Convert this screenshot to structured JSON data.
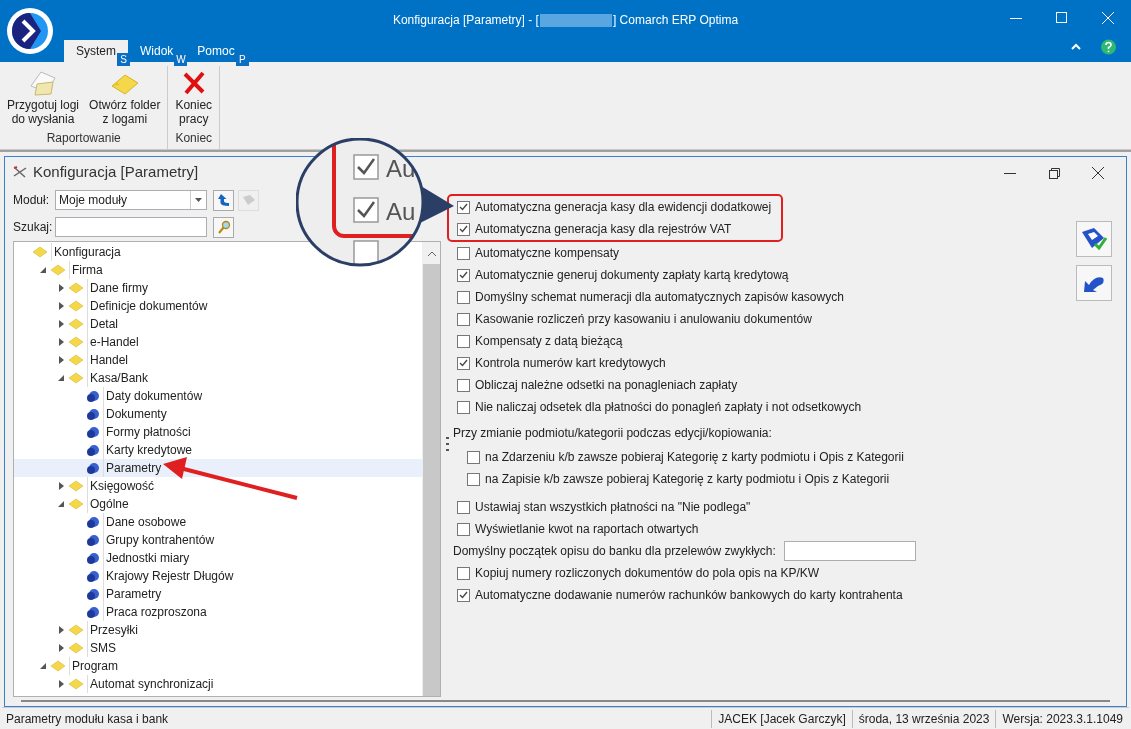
{
  "window": {
    "title_before": "Konfiguracja [Parametry] - [",
    "title_after": "] Comarch ERP Optima"
  },
  "ribbon": {
    "tabs": [
      {
        "label": "System",
        "key": "S",
        "selected": true
      },
      {
        "label": "Widok",
        "key": "W",
        "selected": false
      },
      {
        "label": "Pomoc",
        "key": "P",
        "selected": false
      }
    ],
    "groups": [
      {
        "label": "Raportowanie",
        "buttons": [
          {
            "label": "Przygotuj logi\ndo wysłania",
            "kind": "envelope"
          },
          {
            "label": "Otwórz folder\nz logami",
            "kind": "folder"
          }
        ]
      },
      {
        "label": "Koniec",
        "buttons": [
          {
            "label": "Koniec\npracy",
            "kind": "exit"
          }
        ]
      }
    ]
  },
  "dialog": {
    "title": "Konfiguracja [Parametry]",
    "module_label": "Moduł:",
    "module_value": "Moje moduły",
    "search_label": "Szukaj:"
  },
  "tree": [
    {
      "label": "Konfiguracja",
      "kind": "folder",
      "selected": false,
      "children": [
        {
          "label": "Firma",
          "kind": "folder",
          "expanded": true,
          "selected": false,
          "children": [
            {
              "label": "Dane firmy",
              "kind": "folder",
              "expanded": false,
              "selected": false
            },
            {
              "label": "Definicje dokumentów",
              "kind": "folder",
              "expanded": false,
              "selected": false
            },
            {
              "label": "Detal",
              "kind": "folder",
              "expanded": false,
              "selected": false
            },
            {
              "label": "e-Handel",
              "kind": "folder",
              "expanded": false,
              "selected": false
            },
            {
              "label": "Handel",
              "kind": "folder",
              "expanded": false,
              "selected": false
            },
            {
              "label": "Kasa/Bank",
              "kind": "folder",
              "expanded": true,
              "selected": false,
              "children": [
                {
                  "label": "Daty dokumentów",
                  "kind": "leaf",
                  "selected": false
                },
                {
                  "label": "Dokumenty",
                  "kind": "leaf",
                  "selected": false
                },
                {
                  "label": "Formy płatności",
                  "kind": "leaf",
                  "selected": false
                },
                {
                  "label": "Karty kredytowe",
                  "kind": "leaf",
                  "selected": false
                },
                {
                  "label": "Parametry",
                  "kind": "leaf",
                  "selected": true
                }
              ]
            },
            {
              "label": "Księgowość",
              "kind": "folder",
              "expanded": false,
              "selected": false
            },
            {
              "label": "Ogólne",
              "kind": "folder",
              "expanded": true,
              "selected": false,
              "children": [
                {
                  "label": "Dane osobowe",
                  "kind": "leaf",
                  "selected": false
                },
                {
                  "label": "Grupy kontrahentów",
                  "kind": "leaf",
                  "selected": false
                },
                {
                  "label": "Jednostki miary",
                  "kind": "leaf",
                  "selected": false
                },
                {
                  "label": "Krajowy Rejestr Długów",
                  "kind": "leaf",
                  "selected": false
                },
                {
                  "label": "Parametry",
                  "kind": "leaf",
                  "selected": false
                },
                {
                  "label": "Praca rozproszona",
                  "kind": "leaf",
                  "selected": false
                }
              ]
            },
            {
              "label": "Przesyłki",
              "kind": "folder",
              "expanded": false,
              "selected": false
            },
            {
              "label": "SMS",
              "kind": "folder",
              "expanded": false,
              "selected": false
            }
          ]
        },
        {
          "label": "Program",
          "kind": "folder",
          "expanded": true,
          "selected": false,
          "children": [
            {
              "label": "Automat synchronizacji",
              "kind": "folder",
              "expanded": false,
              "selected": false
            }
          ]
        }
      ]
    }
  ],
  "settings": [
    {
      "kind": "checkbox",
      "label": "Automatyczna generacja kasy dla ewidencji dodatkowej",
      "checked": true,
      "highlighted": true
    },
    {
      "kind": "checkbox",
      "label": "Automatyczna generacja kasy dla rejestrów VAT",
      "checked": true,
      "highlighted": true
    },
    {
      "kind": "checkbox",
      "label": "Automatyczne kompensaty",
      "checked": false
    },
    {
      "kind": "checkbox",
      "label": "Automatycznie generuj dokumenty zapłaty kartą kredytową",
      "checked": true
    },
    {
      "kind": "checkbox",
      "label": "Domyślny schemat numeracji dla automatycznych zapisów kasowych",
      "checked": false
    },
    {
      "kind": "checkbox",
      "label": "Kasowanie rozliczeń przy kasowaniu i anulowaniu dokumentów",
      "checked": false
    },
    {
      "kind": "checkbox",
      "label": "Kompensaty z datą bieżącą",
      "checked": false
    },
    {
      "kind": "checkbox",
      "label": "Kontrola numerów kart kredytowych",
      "checked": true
    },
    {
      "kind": "checkbox",
      "label": "Obliczaj należne odsetki na ponagleniach zapłaty",
      "checked": false
    },
    {
      "kind": "checkbox",
      "label": "Nie naliczaj odsetek dla płatności do ponagleń zapłaty i not odsetkowych",
      "checked": false
    },
    {
      "kind": "heading",
      "label": "Przy zmianie podmiotu/kategorii podczas edycji/kopiowania:"
    },
    {
      "kind": "subcheckbox",
      "label": "na Zdarzeniu k/b zawsze pobieraj Kategorię z karty podmiotu i Opis z Kategorii",
      "checked": false
    },
    {
      "kind": "subcheckbox",
      "label": "na Zapisie k/b zawsze pobieraj Kategorię z karty podmiotu i Opis z Kategorii",
      "checked": false
    },
    {
      "kind": "checkbox",
      "label": "Ustawiaj stan wszystkich płatności na \"Nie podlega\"",
      "checked": false
    },
    {
      "kind": "checkbox",
      "label": "Wyświetlanie kwot na raportach otwartych",
      "checked": false
    },
    {
      "kind": "field",
      "label": "Domyślny początek opisu do banku dla przelewów zwykłych:"
    },
    {
      "kind": "checkbox",
      "label": "Kopiuj numery rozliczonych dokumentów do pola opis na KP/KW",
      "checked": false
    },
    {
      "kind": "checkbox",
      "label": "Automatyczne dodawanie numerów rachunków bankowych do karty kontrahenta",
      "checked": true
    }
  ],
  "callout": {
    "texts": [
      "Au",
      "Au"
    ]
  },
  "status_bar": [
    "Parametry modułu kasa i bank",
    "JACEK [Jacek Garczyk]",
    "środa, 13 września 2023",
    "Wersja: 2023.3.1.1049"
  ]
}
